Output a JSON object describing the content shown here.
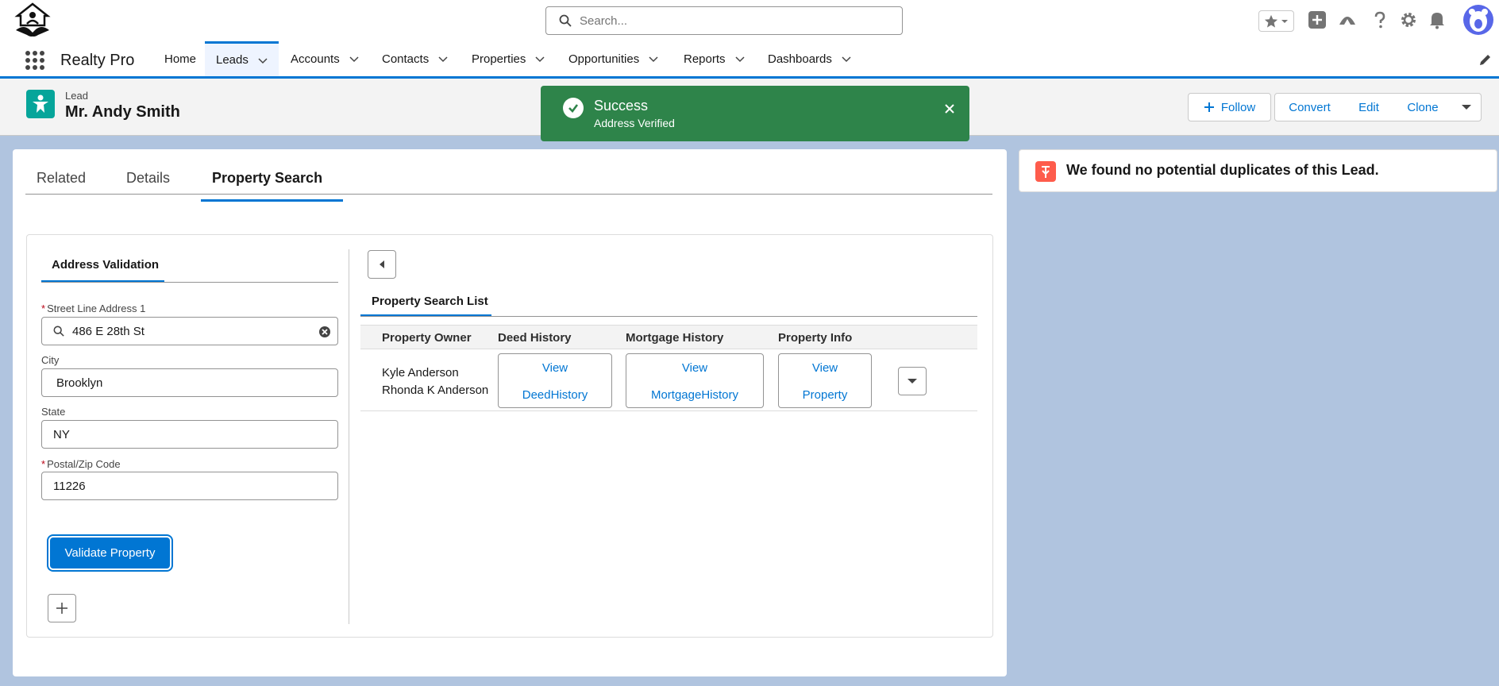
{
  "colors": {
    "brand": "#0176d3",
    "success": "#2e844a",
    "lead_icon": "#06a59a",
    "duplicate_icon": "#fe5c4c",
    "background": "#b0c4df"
  },
  "header": {
    "search_placeholder": "Search...",
    "icons": [
      "favorites-icon",
      "add-icon",
      "trailhead-icon",
      "help-icon",
      "setup-gear-icon",
      "notification-bell-icon",
      "avatar"
    ]
  },
  "nav": {
    "app_name": "Realty Pro",
    "items": [
      {
        "label": "Home"
      },
      {
        "label": "Leads"
      },
      {
        "label": "Accounts"
      },
      {
        "label": "Contacts"
      },
      {
        "label": "Properties"
      },
      {
        "label": "Opportunities"
      },
      {
        "label": "Reports"
      },
      {
        "label": "Dashboards"
      }
    ]
  },
  "record": {
    "type": "Lead",
    "name": "Mr. Andy Smith",
    "actions": {
      "follow": "Follow",
      "convert": "Convert",
      "edit": "Edit",
      "clone": "Clone"
    }
  },
  "toast": {
    "title": "Success",
    "message": "Address Verified"
  },
  "tabs": [
    "Related",
    "Details",
    "Property Search"
  ],
  "address_validation": {
    "tab_label": "Address Validation",
    "street": {
      "label": "Street Line Address 1",
      "value": "486 E 28th St",
      "required": true
    },
    "city": {
      "label": "City",
      "value": "Brooklyn"
    },
    "state": {
      "label": "State",
      "value": "NY"
    },
    "postal": {
      "label": "Postal/Zip Code",
      "value": "11226",
      "required": true
    },
    "validate_label": "Validate Property"
  },
  "property_search": {
    "tab_label": "Property Search List",
    "columns": [
      "Property Owner",
      "Deed History",
      "Mortgage History",
      "Property Info"
    ],
    "row": {
      "owners": [
        "Kyle Anderson",
        "Rhonda K Anderson"
      ],
      "deed": [
        "View",
        "DeedHistory"
      ],
      "mortgage": [
        "View",
        "MortgageHistory"
      ],
      "property": [
        "View",
        "Property"
      ]
    }
  },
  "duplicates": {
    "message": "We found no potential duplicates of this Lead."
  }
}
